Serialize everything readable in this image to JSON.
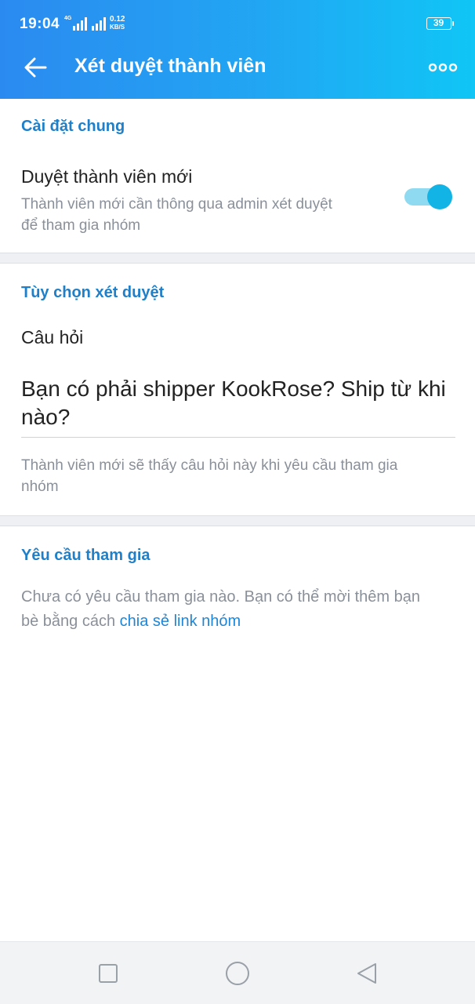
{
  "status_bar": {
    "time": "19:04",
    "network": "4G",
    "speed_value": "0.12",
    "speed_unit": "KB/S",
    "battery": "39"
  },
  "app_bar": {
    "title": "Xét duyệt thành viên",
    "back_icon": "arrow-left-icon",
    "more_icon": "more-horizontal-icon"
  },
  "general": {
    "section_title": "Cài đặt chung",
    "approve_title": "Duyệt thành viên mới",
    "approve_desc_line1": "Thành viên mới cần thông qua admin xét duyệt",
    "approve_desc_line2": "để tham gia nhóm",
    "toggle_on": true
  },
  "review_options": {
    "section_title": "Tùy chọn xét duyệt",
    "question_label": "Câu hỏi",
    "question_value": "Bạn có phải shipper KookRose? Ship từ khi nào?",
    "question_hint_line1": "Thành viên mới sẽ thấy câu hỏi này khi yêu cầu tham gia",
    "question_hint_line2": "nhóm"
  },
  "join_requests": {
    "section_title": "Yêu cầu tham gia",
    "empty_text_1": "Chưa có yêu cầu tham gia nào. Bạn có thể mời thêm bạn",
    "empty_text_2": "bè bằng cách ",
    "share_link": "chia sẻ link nhóm"
  },
  "colors": {
    "accent": "#1f7fc8",
    "link": "#1f86d6",
    "header_start": "#2b8af0",
    "header_end": "#10c6f6",
    "toggle_track": "#8fdaf0",
    "toggle_knob": "#12b4e6"
  },
  "nav_bar": {
    "icons": [
      "square-icon",
      "circle-icon",
      "triangle-back-icon"
    ]
  }
}
